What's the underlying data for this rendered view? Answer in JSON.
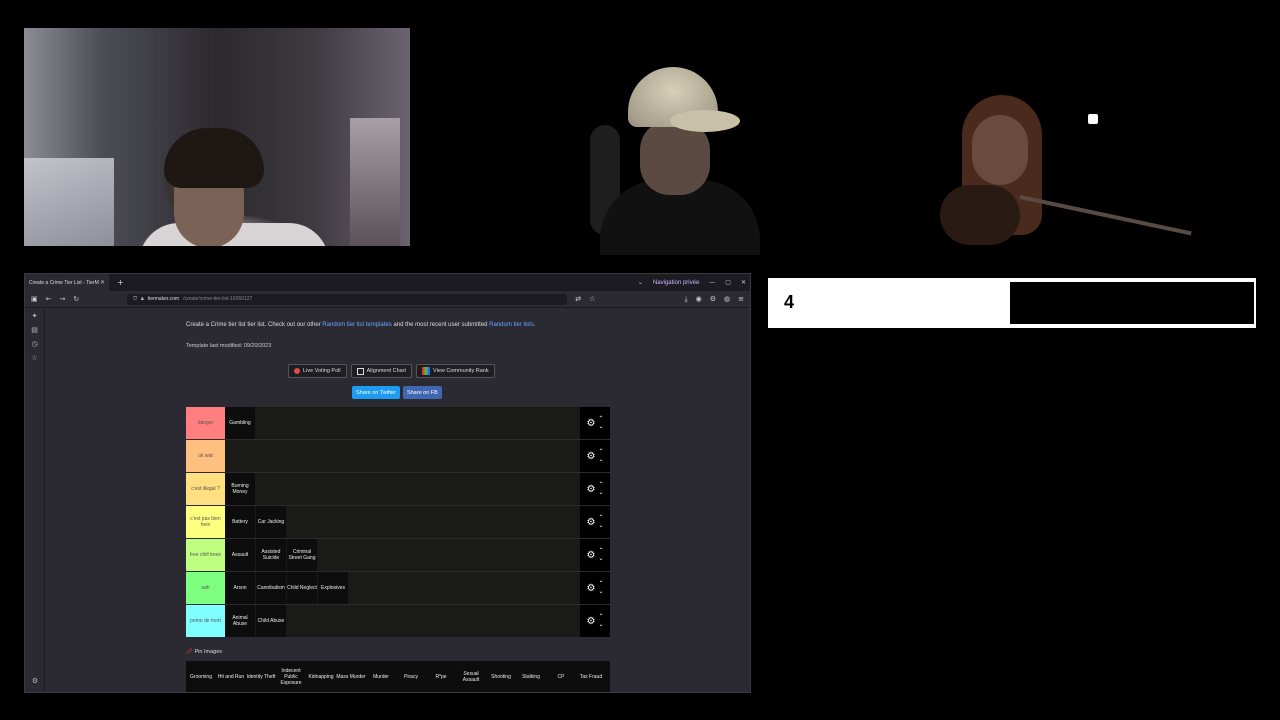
{
  "counter": {
    "value": "4"
  },
  "browser": {
    "tab_title": "Create a Crime Tier List - TierM",
    "new_tab": "+",
    "private_label": "Navigation privée",
    "url_domain": "tiermaker.com",
    "url_path": "/create/crime-tier-list-16260127",
    "window_controls": [
      "—",
      "▢",
      "✕"
    ]
  },
  "page": {
    "intro_text": "Create a Crime tier list tier list. Check out our other",
    "intro_link1": "Random tier list templates",
    "intro_mid": "and the most recent user submitted",
    "intro_link2": "Random tier lists",
    "intro_end": ".",
    "modified": "Template last modified: 09/20/2023",
    "buttons": {
      "live_voting": "Live Voting Poll",
      "alignment": "Alignment Chart",
      "community_rank": "View Community Rank"
    },
    "share_twitter": "Share on Twitter",
    "share_fb": "Share on FB",
    "pin_images": "Pin Images"
  },
  "tiers": [
    {
      "label": "danger",
      "color": "#ff7f7f",
      "items": [
        "Gambling"
      ]
    },
    {
      "label": "ok wat",
      "color": "#ffbf7f",
      "items": []
    },
    {
      "label": "c'est illegal ?",
      "color": "#ffdf7f",
      "items": [
        "Burning Money"
      ]
    },
    {
      "label": "c'est pas bien hein",
      "color": "#ffff7f",
      "items": [
        "Battery",
        "Car Jacking"
      ]
    },
    {
      "label": "free chill trees",
      "color": "#bfff7f",
      "items": [
        "Assault",
        "Assisted Suicide",
        "Criminal Street Gang"
      ]
    },
    {
      "label": "sah",
      "color": "#7fff7f",
      "items": [
        "Arson",
        "Cannibalism",
        "Child Neglect",
        "Explosives"
      ]
    },
    {
      "label": "pomo de mort",
      "color": "#7fffff",
      "items": [
        "Animal Abuse",
        "Child Abuse"
      ]
    }
  ],
  "pool": [
    "Grooming",
    "Hit and Run",
    "Identity Theft",
    "Indecent Public Exposure",
    "Kidnapping",
    "Mass Murder",
    "Murder",
    "Piracy",
    "R*pe",
    "Sexual Assault",
    "Shooting",
    "Stalking",
    "CP",
    "Tax Fraud"
  ]
}
